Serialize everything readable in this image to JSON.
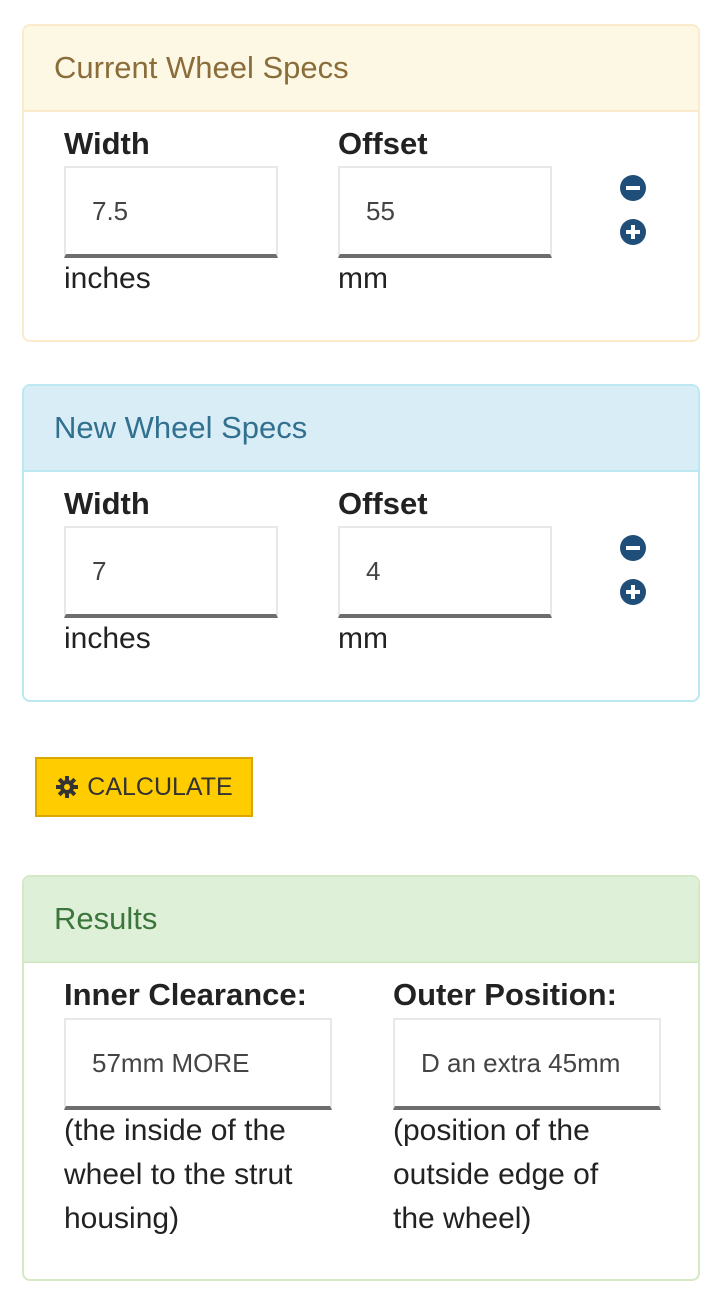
{
  "current": {
    "heading": "Current Wheel Specs",
    "width_label": "Width",
    "width_value": "7.5",
    "width_unit": "inches",
    "offset_label": "Offset",
    "offset_value": "55",
    "offset_unit": "mm"
  },
  "new": {
    "heading": "New Wheel Specs",
    "width_label": "Width",
    "width_value": "7",
    "width_unit": "inches",
    "offset_label": "Offset",
    "offset_value": "4",
    "offset_unit": "mm"
  },
  "calculate": {
    "label": "CALCULATE",
    "icon": "gear-icon"
  },
  "results": {
    "heading": "Results",
    "inner_label": "Inner Clearance:",
    "inner_value": "57mm MORE",
    "inner_note_lines": [
      "(the inside of the",
      "wheel to the strut",
      "housing)"
    ],
    "outer_label": "Outer Position:",
    "outer_value": "D an extra 45mm",
    "outer_note_lines": [
      "(position of the",
      "outside edge of",
      "the wheel)"
    ]
  },
  "colors": {
    "warning_bg": "#fcf8e3",
    "info_bg": "#d9edf7",
    "success_bg": "#dff0d8",
    "button_yellow": "#ffcc00",
    "icon_blue": "#1f4e79"
  }
}
